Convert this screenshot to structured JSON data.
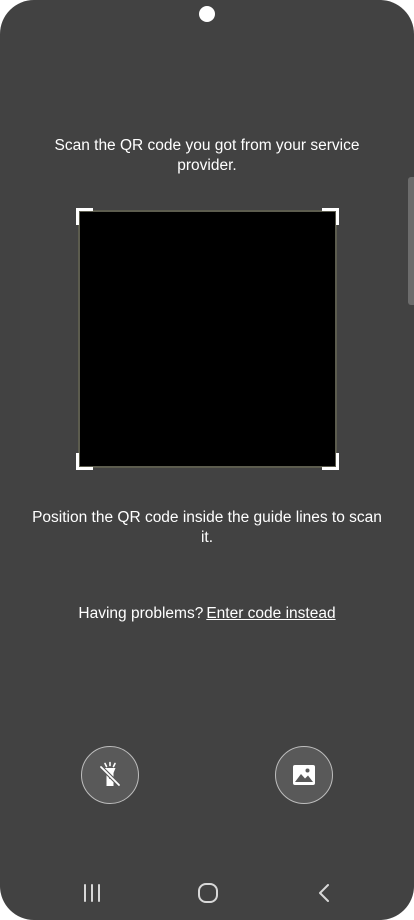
{
  "scan": {
    "title": "Scan the QR code you got from your service provider.",
    "hint": "Position the QR code inside the guide lines to scan it."
  },
  "help": {
    "prompt": "Having problems?",
    "link": "Enter code instead"
  },
  "actions": {
    "flashlight_icon": "flashlight-off-icon",
    "gallery_icon": "image-gallery-icon"
  },
  "navbar": {
    "recents_icon": "recents-icon",
    "home_icon": "home-icon",
    "back_icon": "back-icon"
  },
  "colors": {
    "background": "#424242",
    "viewfinder": "#000000",
    "text": "#ffffff"
  }
}
